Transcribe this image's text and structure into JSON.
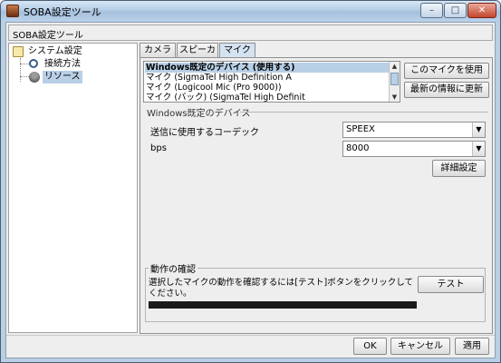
{
  "window": {
    "title": "SOBA設定ツール",
    "controls": {
      "minimize": "–",
      "maximize": "□",
      "close": "✕"
    }
  },
  "panel_header": "SOBA設定ツール",
  "tree": {
    "root": "システム設定",
    "children": [
      "接続方法",
      "リソース"
    ],
    "selected": "リソース"
  },
  "tabs": [
    "カメラ",
    "スピーカ",
    "マイク"
  ],
  "active_tab": "マイク",
  "mic_list": {
    "items": [
      "Windows既定のデバイス (使用する)",
      "マイク (SigmaTel High Definition A",
      "マイク (Logicool Mic (Pro 9000))",
      "マイク (バック) (SigmaTel High Definit"
    ],
    "selected_index": 0,
    "scroll_up": "▲",
    "scroll_down": "▼"
  },
  "buttons": {
    "use_mic": "このマイクを使用",
    "refresh": "最新の情報に更新",
    "advanced": "詳細設定",
    "test": "テスト",
    "ok": "OK",
    "cancel": "キャンセル",
    "apply": "適用"
  },
  "device_group": {
    "title": "Windows既定のデバイス",
    "codec_label": "送信に使用するコーデック",
    "codec_value": "SPEEX",
    "bps_label": "bps",
    "bps_value": "8000",
    "dropdown_glyph": "▼"
  },
  "confirm_group": {
    "title": "動作の確認",
    "text": "選択したマイクの動作を確認するには[テスト]ボタンをクリックしてください。",
    "level": 0
  }
}
